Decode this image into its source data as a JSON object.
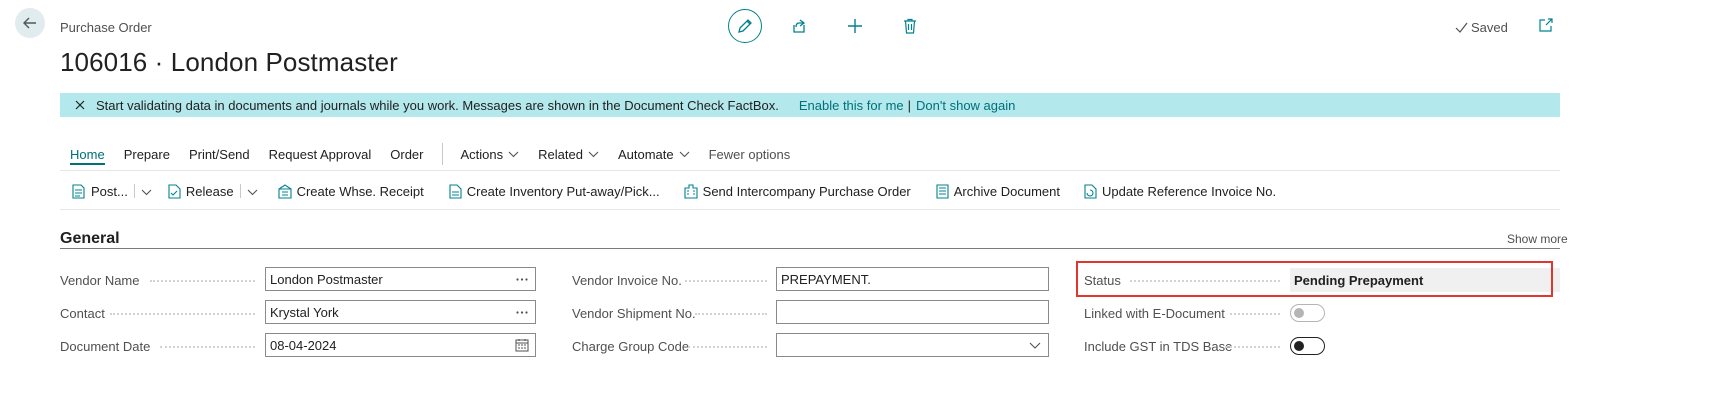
{
  "header": {
    "breadcrumb": "Purchase Order",
    "title": "106016 · London Postmaster",
    "saved_label": "Saved"
  },
  "banner": {
    "message": "Start validating data in documents and journals while you work. Messages are shown in the Document Check FactBox.",
    "enable_link": "Enable this for me",
    "separator": "|",
    "dismiss_link": "Don't show again"
  },
  "menu": {
    "items": [
      "Home",
      "Prepare",
      "Print/Send",
      "Request Approval",
      "Order"
    ],
    "dropdowns": [
      "Actions",
      "Related",
      "Automate"
    ],
    "fewer_options": "Fewer options"
  },
  "actions": {
    "post": "Post...",
    "release": "Release",
    "create_whse_receipt": "Create Whse. Receipt",
    "create_inventory": "Create Inventory Put-away/Pick...",
    "send_intercompany": "Send Intercompany Purchase Order",
    "archive": "Archive Document",
    "update_ref": "Update Reference Invoice No."
  },
  "section": {
    "title": "General",
    "show_more": "Show more"
  },
  "fields": {
    "vendor_name": {
      "label": "Vendor Name",
      "value": "London Postmaster"
    },
    "contact": {
      "label": "Contact",
      "value": "Krystal York"
    },
    "document_date": {
      "label": "Document Date",
      "value": "08-04-2024"
    },
    "vendor_invoice_no": {
      "label": "Vendor Invoice No.",
      "value": "PREPAYMENT."
    },
    "vendor_shipment_no": {
      "label": "Vendor Shipment No.",
      "value": ""
    },
    "charge_group_code": {
      "label": "Charge Group Code",
      "value": ""
    },
    "status": {
      "label": "Status",
      "value": "Pending Prepayment"
    },
    "linked_e_document": {
      "label": "Linked with E-Document",
      "value": "off"
    },
    "include_gst_tds": {
      "label": "Include GST in TDS Base",
      "value": "off"
    }
  },
  "colors": {
    "accent": "#00828f",
    "banner_bg": "#b3e8ec",
    "highlight_border": "#e0362e"
  },
  "icons": {
    "back": "arrow-left-icon",
    "edit": "pencil-icon",
    "share": "share-icon",
    "new": "plus-icon",
    "delete": "trash-icon",
    "saved": "checkmark-icon",
    "popout": "popout-icon",
    "close": "close-icon",
    "lookup": "ellipsis-icon",
    "calendar": "calendar-icon",
    "dropdown": "chevron-down-icon"
  }
}
